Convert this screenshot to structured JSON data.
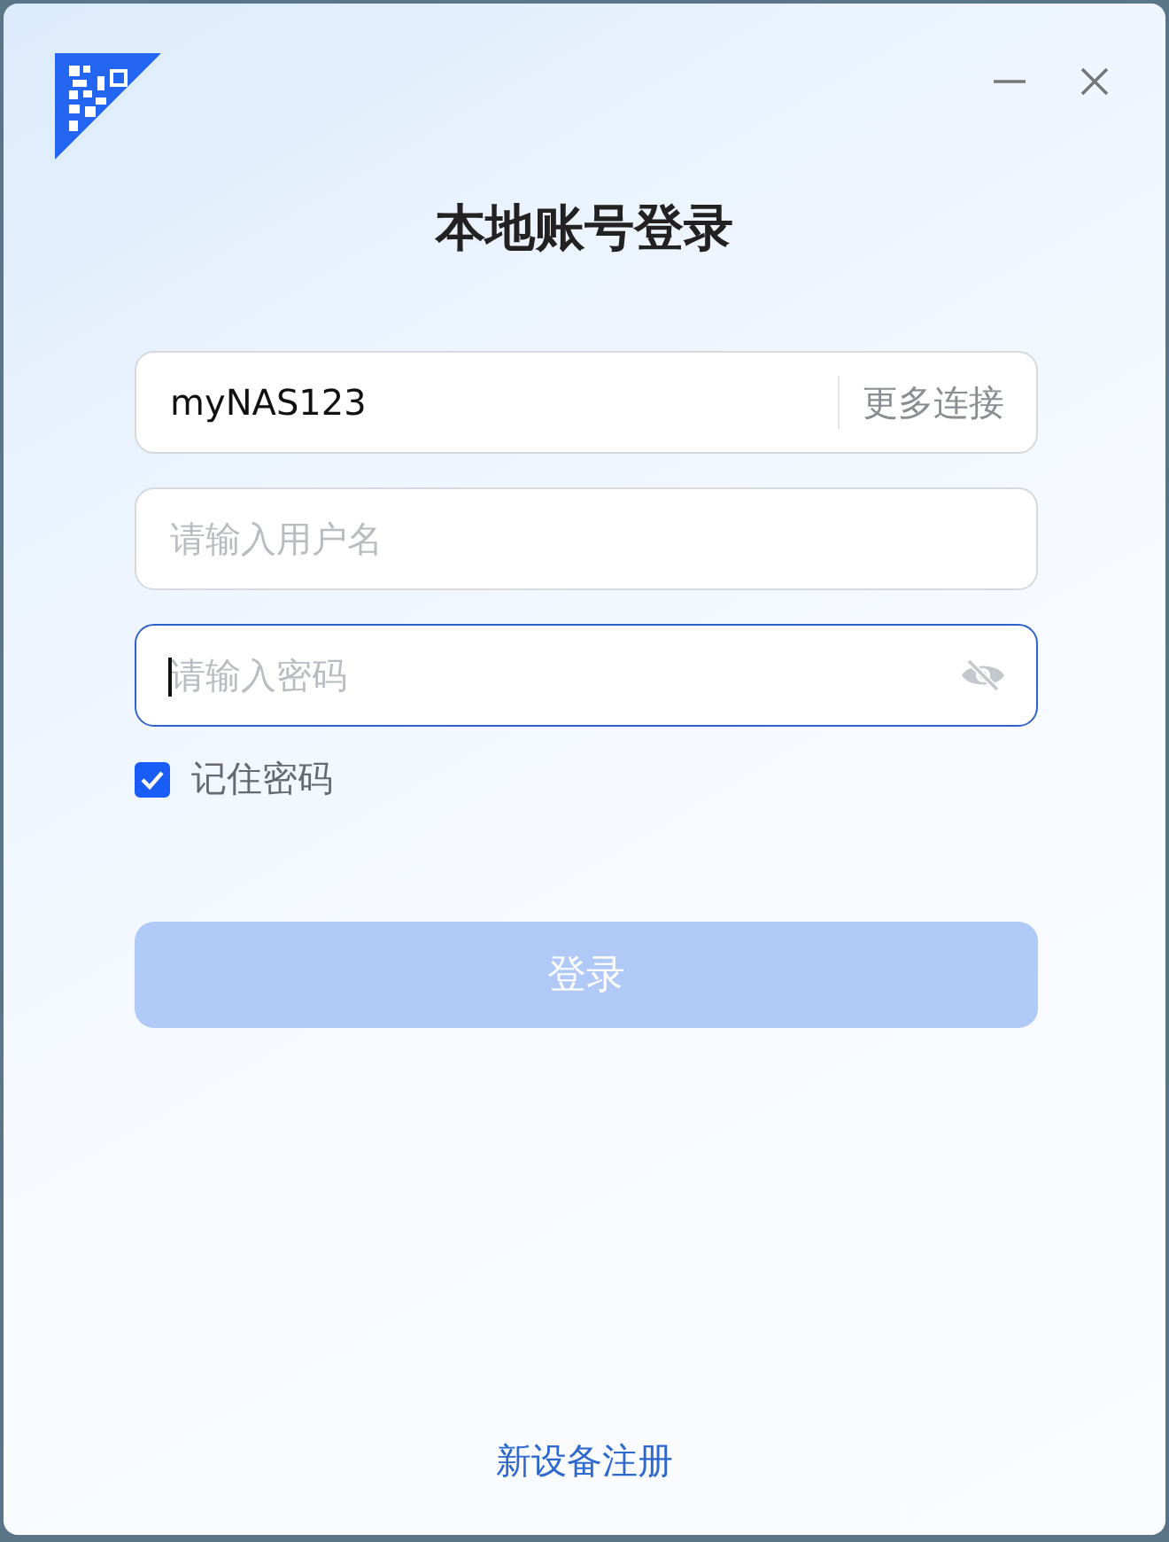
{
  "title": "本地账号登录",
  "server": {
    "value": "myNAS123",
    "more_link": "更多连接"
  },
  "username": {
    "placeholder": "请输入用户名",
    "focused": false
  },
  "password": {
    "placeholder": "请输入密码",
    "focused": true,
    "visible": false
  },
  "remember": {
    "label": "记住密码",
    "checked": true
  },
  "login_button": {
    "label": "登录",
    "disabled": true
  },
  "register_link": "新设备注册"
}
